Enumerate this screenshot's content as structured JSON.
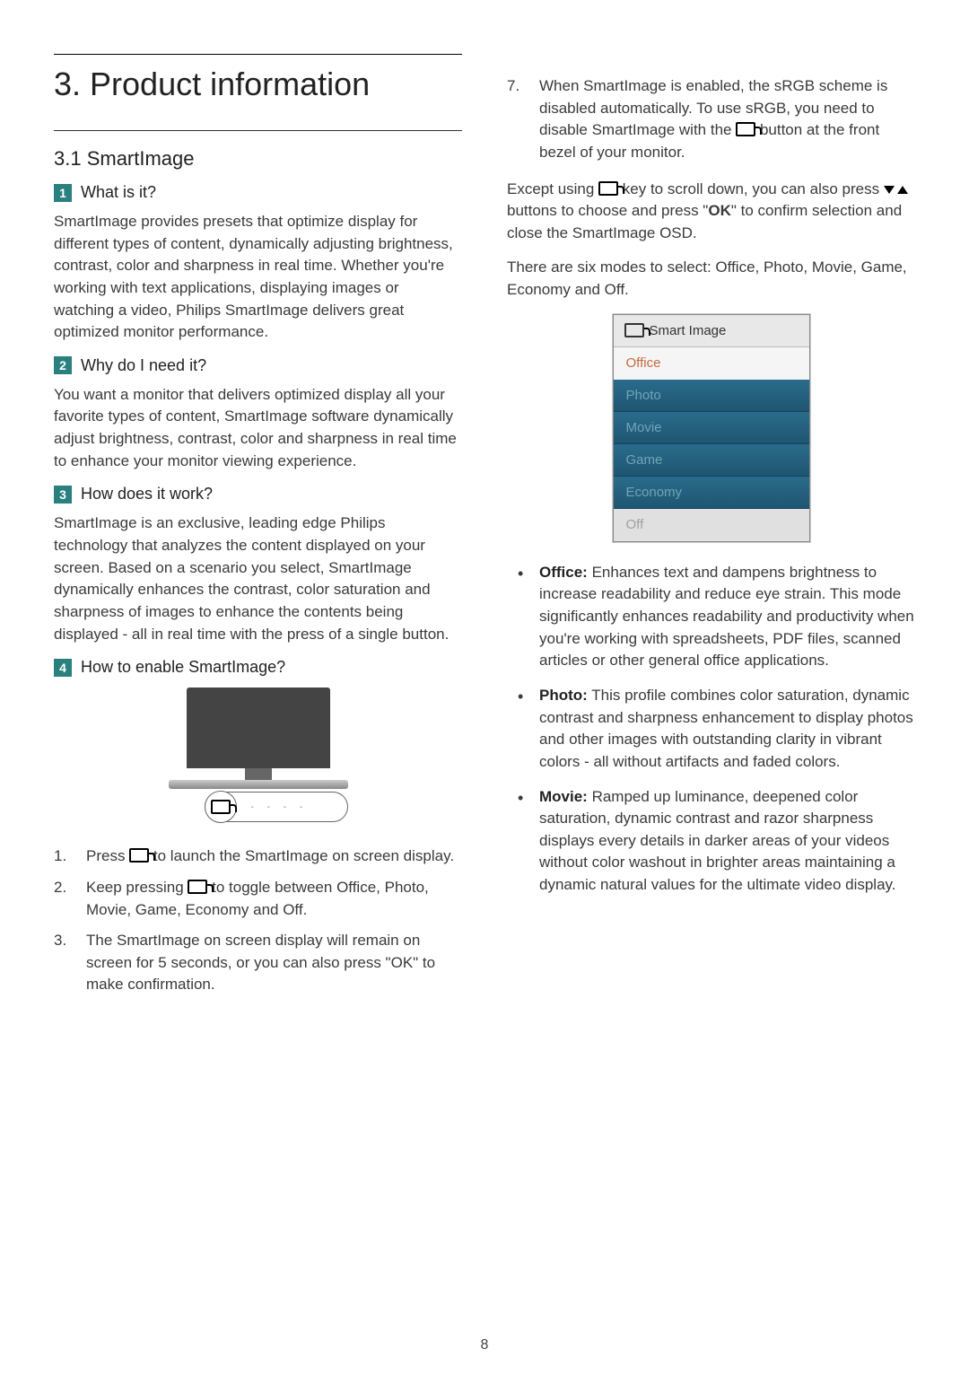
{
  "page": {
    "title": "3.  Product information",
    "section": "3.1  SmartImage",
    "pageNumber": "8"
  },
  "headings": {
    "h1": {
      "num": "1",
      "text": "What is it?"
    },
    "h2": {
      "num": "2",
      "text": "Why do I need it?"
    },
    "h3": {
      "num": "3",
      "text": "How does it work?"
    },
    "h4": {
      "num": "4",
      "text": "How to enable SmartImage?"
    }
  },
  "paragraphs": {
    "p1": "SmartImage provides presets that optimize display for different types of content, dynamically adjusting brightness, contrast, color and sharpness in real time. Whether you're working with text applications, displaying images or watching a video, Philips SmartImage delivers great optimized monitor performance.",
    "p2": "You want a monitor that delivers optimized display all your favorite types of content, SmartImage software dynamically adjust brightness, contrast, color and sharpness in real time to enhance your monitor viewing experience.",
    "p3": "SmartImage is an exclusive, leading edge Philips technology that analyzes the content displayed on your screen. Based on a scenario you select, SmartImage dynamically enhances the contrast, color saturation and sharpness of images to enhance the contents being displayed - all in real time with the press of a single button.",
    "step4a": "When SmartImage is enabled, the sRGB scheme is disabled automatically. To use sRGB, you need to disable SmartImage with the ",
    "step4b": " button at the front bezel of your monitor.",
    "except_a": "Except using ",
    "except_b": " key to scroll down, you can also press ",
    "except_c": " buttons to choose and press \"",
    "except_ok": "OK",
    "except_d": "\" to confirm selection and close the SmartImage OSD.",
    "sixmodes": "There are six modes to select: Office, Photo, Movie, Game, Economy and Off."
  },
  "steps": {
    "s1a": "Press ",
    "s1b": " to launch the SmartImage on screen display.",
    "s2a": "Keep pressing ",
    "s2b": " to toggle between Office, Photo, Movie, Game, Economy and Off.",
    "s3": "The SmartImage on screen display will remain on screen for 5 seconds, or you can also press \"OK\" to make confirmation."
  },
  "osd": {
    "header": "Smart Image",
    "items": [
      "Office",
      "Photo",
      "Movie",
      "Game",
      "Economy",
      "Off"
    ]
  },
  "modes": {
    "office": {
      "label": "Office:",
      "text": " Enhances text and dampens brightness to increase readability and reduce eye strain. This mode significantly enhances readability and productivity when you're working with spreadsheets, PDF files, scanned articles or other general office applications."
    },
    "photo": {
      "label": "Photo:",
      "text": " This profile combines color saturation, dynamic contrast and sharpness enhancement to display photos and other images with outstanding clarity in vibrant colors - all without artifacts and faded colors."
    },
    "movie": {
      "label": "Movie:",
      "text": " Ramped up luminance, deepened color saturation, dynamic contrast and razor sharpness displays every details in darker areas of your videos without color washout in brighter areas maintaining a dynamic natural values for the ultimate video display."
    }
  }
}
